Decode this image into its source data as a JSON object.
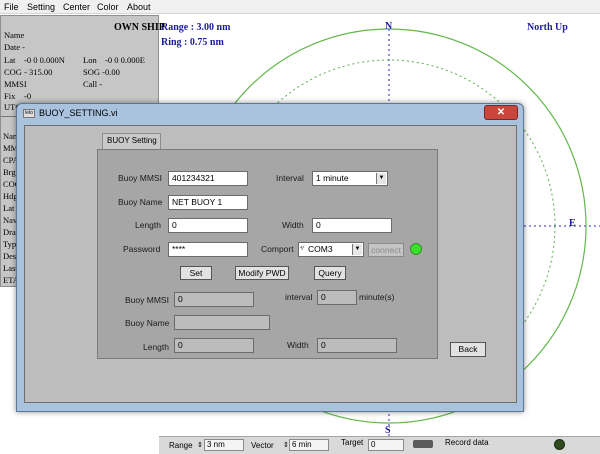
{
  "menu": {
    "items": [
      "File",
      "Setting",
      "Center",
      "Color",
      "About"
    ]
  },
  "radar": {
    "range_text": "Range : 3.00  nm",
    "ring_text": "Ring : 0.75  nm",
    "orientation": "North Up",
    "north_label": "N",
    "east_label": "E",
    "south_label": "S",
    "colors": {
      "outer_ring": "#62b84b",
      "inner_ring": "#5ab04a",
      "crosshair": "#2a2ab0"
    }
  },
  "ownship": {
    "title": "OWN SHIP",
    "name_label": "Name",
    "date_label": "Date -",
    "lat_label": "Lat",
    "lat_value": "-0 0 0.000N",
    "lon_label": "Lon",
    "lon_value": "-0 0 0.000E",
    "cog_label": "COG - 315.00",
    "sog_label": "SOG -0.00",
    "mmsi_label": "MMSI",
    "call_label": "Call -",
    "fix_label": "Fix",
    "fix_value": "-0",
    "utc_label": "UTC -0",
    "target_fields": [
      "Nam",
      "MMS",
      "CPA",
      "Brg",
      "COG",
      "Hdg",
      "Lat",
      "Nav",
      "Dra",
      "Type",
      "Dest",
      "Last",
      "ETA"
    ]
  },
  "bottom": {
    "range_label": "Range",
    "range_value": "3 nm",
    "vector_label": "Vector",
    "vector_value": "6 min",
    "target_label": "Target",
    "target_value": "0",
    "record_label": "Record data"
  },
  "dialog": {
    "title": "BUOY_SETTING.vi",
    "icon_text": "lelo",
    "close_glyph": "✕",
    "tab_label": "BUOY Setting",
    "form": {
      "buoy_mmsi_label": "Buoy MMSI",
      "buoy_mmsi_value": "401234321",
      "interval_label": "Interval",
      "interval_value": "1 minute",
      "buoy_name_label": "Buoy Name",
      "buoy_name_value": "NET BUOY 1",
      "length_label": "Length",
      "length_value": "0",
      "width_label": "Width",
      "width_value": "0",
      "password_label": "Password",
      "password_value": "****",
      "comport_label": "Comport",
      "comport_value": "COM3",
      "connect_label": "connect",
      "set_label": "Set",
      "modify_pwd_label": "Modify PWD",
      "query_label": "Query"
    },
    "readback": {
      "buoy_mmsi_label": "Buoy MMSI",
      "buoy_mmsi_value": "0",
      "interval_label": "interval",
      "interval_value": "0",
      "interval_unit": "minute(s)",
      "buoy_name_label": "Buoy Name",
      "buoy_name_value": "",
      "length_label": "Length",
      "length_value": "0",
      "width_label": "Width",
      "width_value": "0"
    },
    "back_label": "Back",
    "connection_led_color": "#38e22a"
  }
}
